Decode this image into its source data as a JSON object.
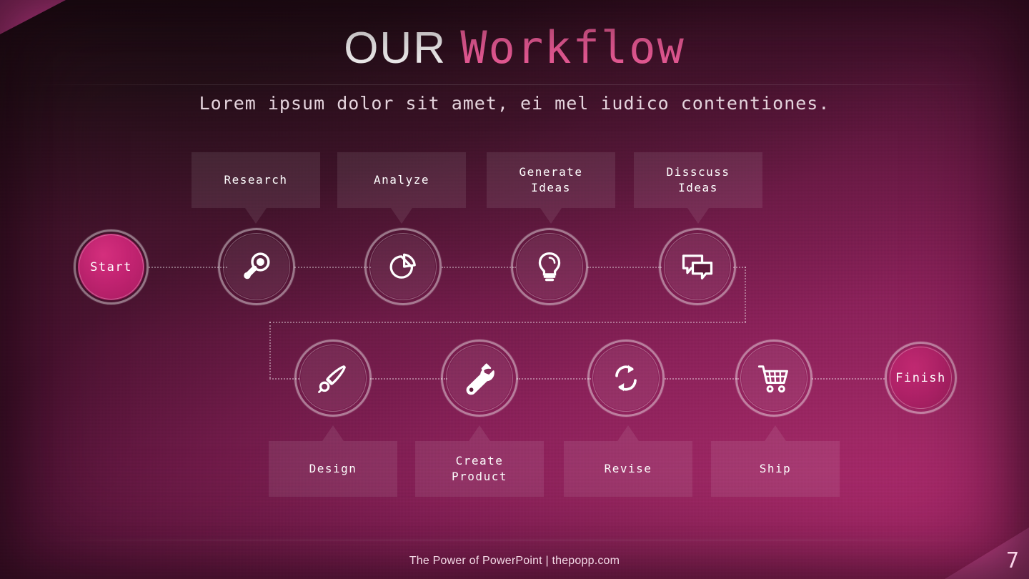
{
  "slide": {
    "title_plain": "OUR ",
    "title_accent": "Workflow",
    "subtitle": "Lorem ipsum dolor sit amet, ei mel iudico contentiones.",
    "page_number": "7",
    "footer": "The Power of PowerPoint | thepopp.com",
    "colors": {
      "accent_pink": "#f7619f",
      "corner_pink": "#d9429a",
      "terminal_fill": "#c32472",
      "background_dark": "#241016",
      "background_magenta": "#b82c74",
      "text_white": "#ffffff"
    }
  },
  "diagram": {
    "start_node": {
      "label": "Start",
      "type": "terminal"
    },
    "finish_node": {
      "label": "Finish",
      "type": "terminal"
    },
    "top_labels": [
      {
        "text": "Research"
      },
      {
        "text": "Analyze"
      },
      {
        "text": "Generate\nIdeas"
      },
      {
        "text": "Disscuss\nIdeas"
      }
    ],
    "bottom_labels": [
      {
        "text": "Design"
      },
      {
        "text": "Create\nProduct"
      },
      {
        "text": "Revise"
      },
      {
        "text": "Ship"
      }
    ],
    "row1_nodes": [
      {
        "icon": "magnifier-icon",
        "label": "Research"
      },
      {
        "icon": "pie-chart-icon",
        "label": "Analyze"
      },
      {
        "icon": "lightbulb-icon",
        "label": "Generate Ideas"
      },
      {
        "icon": "speech-bubbles-icon",
        "label": "Disscuss Ideas"
      }
    ],
    "row2_nodes": [
      {
        "icon": "paintbrush-icon",
        "label": "Design"
      },
      {
        "icon": "wrench-icon",
        "label": "Create Product"
      },
      {
        "icon": "refresh-cycle-icon",
        "label": "Revise"
      },
      {
        "icon": "shopping-cart-icon",
        "label": "Ship"
      }
    ]
  }
}
